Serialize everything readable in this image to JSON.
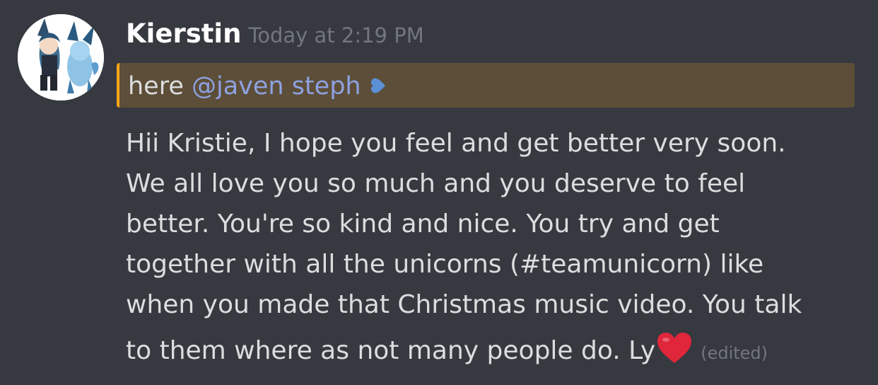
{
  "message": {
    "author": "Kierstin",
    "timestamp": "Today at 2:19 PM",
    "mention_prefix": "here ",
    "mention": "@javen steph",
    "lines": [
      "Hii Kristie, I hope you feel and get better very soon.",
      "We all love you so much and you deserve to feel",
      "better. You're so kind and nice. You try and get",
      "together with all the unicorns (#teamunicorn) like",
      "when you made that Christmas music video. You talk",
      "to them where as not many people do. Ly"
    ],
    "edited_label": "(edited)"
  },
  "colors": {
    "background": "#36393f",
    "mention_highlight": "#5c4e38",
    "mention_bar": "#faa61a",
    "mention_text": "#8ea1e1",
    "heart": "#e0263a"
  },
  "icons": {
    "mention_heart": "blue-heart-icon",
    "line_end_heart": "red-heart-icon",
    "avatar": "avatar-image"
  }
}
